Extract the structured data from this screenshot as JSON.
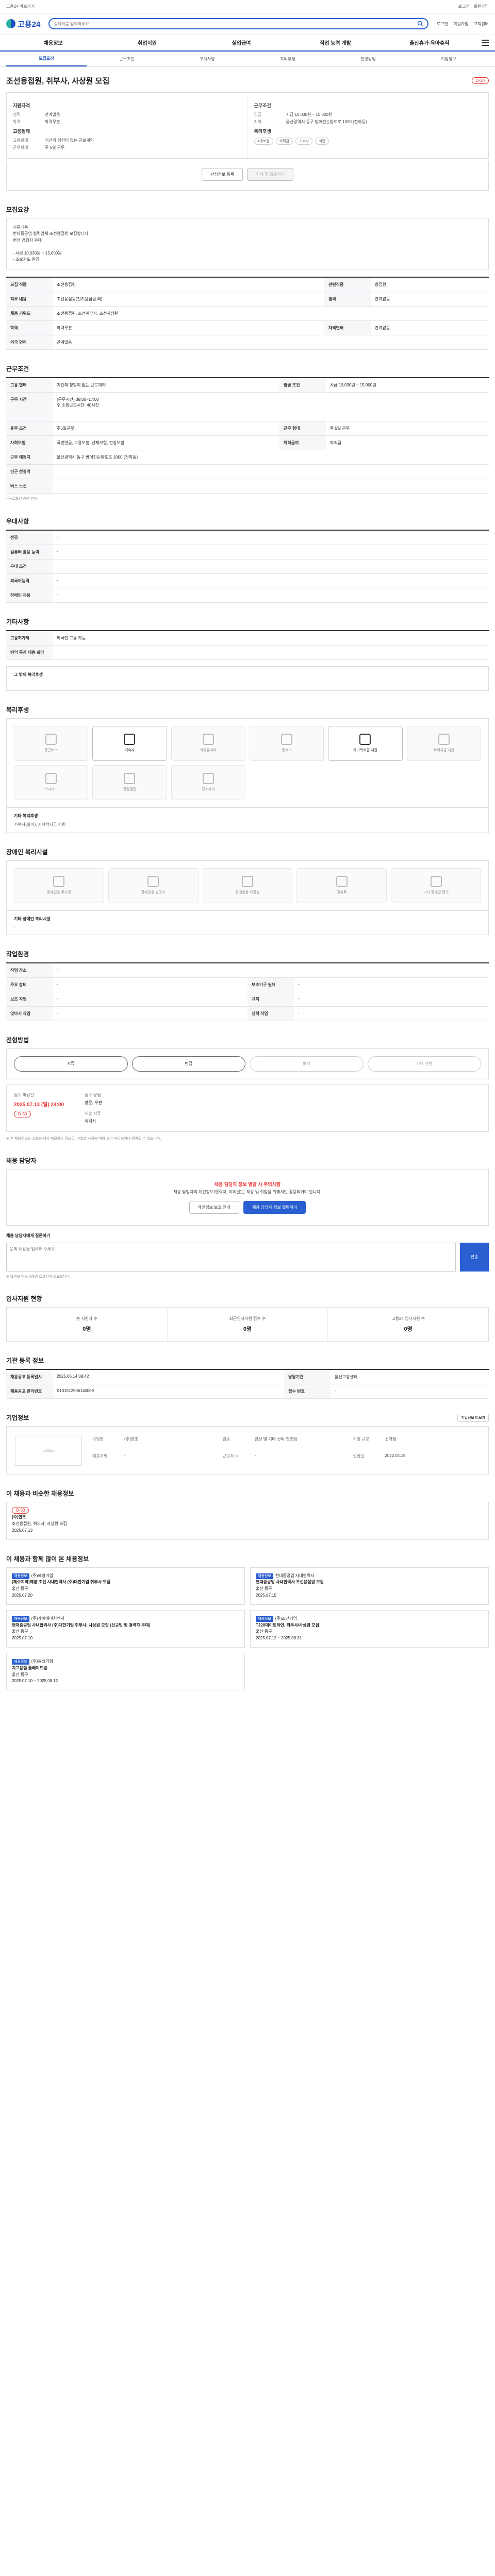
{
  "topbar": {
    "left": "고용24 바로가기",
    "right": [
      "로그인",
      "회원가입"
    ]
  },
  "header": {
    "logo": "고용24",
    "search_placeholder": "검색어를 입력하세요",
    "right": [
      "로그인",
      "회원가입",
      "고객센터"
    ]
  },
  "gnb": [
    "채용정보",
    "취업지원",
    "실업급여",
    "직업 능력 개발",
    "출산휴가·육아휴직"
  ],
  "tabs": [
    "모집요강",
    "근무조건",
    "우대사항",
    "복리후생",
    "전형방법",
    "기업정보"
  ],
  "title": "조선용접원, 취부사, 사상원 모집",
  "dday": "D-30",
  "summary": {
    "left_head": "지원자격",
    "left": [
      {
        "k": "경력",
        "v": "관계없음"
      },
      {
        "k": "학력",
        "v": "학력무관"
      }
    ],
    "left_head2": "고용형태",
    "left2": [
      {
        "k": "고용형태",
        "v": "기간의 정함이 없는 근로계약"
      },
      {
        "k": "근무형태",
        "v": "주 5일 근무"
      }
    ],
    "right_head": "근무조건",
    "right": [
      {
        "k": "임금",
        "v": "시급 10,030원 ~ 15,000원"
      },
      {
        "k": "지역",
        "v": "울산광역시 동구 방어진순환도로 1000 (전하동)"
      }
    ],
    "right_head2": "복리후생",
    "right_pills": [
      "4대보험",
      "퇴직금",
      "기숙사",
      "식당"
    ]
  },
  "buttons": {
    "interest": "관심정보 등록",
    "print": "인쇄 및 공유하기"
  },
  "sections": {
    "recruit": "모집요강",
    "duty_head": "직무내용",
    "duty_text": "직무내용\n현대중공업 협력업체 조선용접원 모집합니다.\n현장 경험자 우대\n\n- 시급 10,030원 ~ 15,000원\n- 초보자도 환영",
    "recruit_rows": [
      {
        "k": "모집 직종",
        "v": "조선용접원",
        "k2": "관련직종",
        "v2": "용접원"
      },
      {
        "k": "직무 내용",
        "v": "조선용접원(전기용접원 외)",
        "k2": "경력",
        "v2": "관계없음"
      },
      {
        "k": "채용 키워드",
        "v": "조선용접원, 조선취부사, 조선사상원",
        "k2": "",
        "v2": ""
      },
      {
        "k": "학력",
        "v": "학력무관",
        "k2": "자격면허",
        "v2": "관계없음"
      },
      {
        "k": "외국 면허",
        "v": "관계없음",
        "k2": "",
        "v2": ""
      }
    ],
    "work": "근무조건",
    "work_rows": [
      {
        "k": "고용 형태",
        "v": "기간의 정함이 없는 근로계약",
        "k2": "임금 조건",
        "v2": "시급 10,030원 ~ 15,000원"
      },
      {
        "k": "근무 시간",
        "v": "(근무시간) 08:00~17:00\n주 소정근로시간: 40시간",
        "k2": "",
        "v2": ""
      },
      {
        "k": "휴무 조건",
        "v": "주5일근무",
        "k2": "근무 형태",
        "v2": "주 5일 근무"
      },
      {
        "k": "사회보험",
        "v": "국민연금, 고용보험, 산재보험, 건강보험",
        "k2": "퇴직급여",
        "v2": "퇴직금"
      },
      {
        "k": "근무 예정지",
        "v": "울산광역시 동구 방어진순환도로 1000 (전하동)",
        "k2": "",
        "v2": ""
      },
      {
        "k": "인근 전철역",
        "v": "",
        "k2": "",
        "v2": ""
      },
      {
        "k": "버스 노선",
        "v": "",
        "k2": "",
        "v2": ""
      }
    ],
    "work_note": "* 근로조건 관련 안내",
    "pref": "우대사항",
    "pref_rows": [
      {
        "k": "전공",
        "v": "-"
      },
      {
        "k": "컴퓨터 활용 능력",
        "v": "-"
      },
      {
        "k": "우대 조건",
        "v": "-"
      },
      {
        "k": "외국어능력",
        "v": "-"
      },
      {
        "k": "장애인 채용",
        "v": "-"
      }
    ],
    "etc": "기타사항",
    "etc_rows": [
      {
        "k": "고용허가제",
        "v": "외국인 고용 가능"
      },
      {
        "k": "병역 특례 채용 희망",
        "v": "-"
      }
    ],
    "etc_box_head": "그 밖의 복리후생",
    "etc_box_text": "-",
    "welfare": "복리후생",
    "welfare_icons": [
      {
        "label": "통근버스",
        "on": false
      },
      {
        "label": "기숙사",
        "on": true
      },
      {
        "label": "차량유지비",
        "on": false
      },
      {
        "label": "중식비",
        "on": false
      },
      {
        "label": "자녀학자금 지원",
        "on": true
      },
      {
        "label": "주택자금 지원",
        "on": false
      },
      {
        "label": "복지카드",
        "on": false
      },
      {
        "label": "건강검진",
        "on": false
      },
      {
        "label": "경조사비",
        "on": false
      }
    ],
    "welfare_extra_head": "기타 복리후생",
    "welfare_extra_text": "기숙사(실비), 자녀학자금 지원",
    "disabled": "장애인 복리시설",
    "disabled_icons": [
      "장애인용 주차장",
      "장애인용 승강기",
      "장애인용 화장실",
      "경사로",
      "기타 장애인 편의"
    ],
    "disabled_extra_head": "기타 장애인 복리시설",
    "disabled_extra_text": "-",
    "env": "작업환경",
    "env_rows": [
      {
        "k": "작업 장소",
        "v": "-",
        "k2": "",
        "v2": ""
      },
      {
        "k": "주요 장비",
        "v": "-",
        "k2": "보조기구 필요",
        "v2": "-"
      },
      {
        "k": "보조 작업",
        "v": "-",
        "k2": "규칙",
        "v2": "-"
      },
      {
        "k": "앉아서 작업",
        "v": "-",
        "k2": "청력 작업",
        "v2": "-"
      }
    ],
    "process": "전형방법",
    "process_steps": [
      {
        "label": "서류",
        "on": true
      },
      {
        "label": "면접",
        "on": true
      },
      {
        "label": "필기",
        "on": false
      },
      {
        "label": "기타 전형",
        "on": false
      }
    ],
    "apply_lbl1": "접수 마감일",
    "apply_date": "2025.07.13 (일) 24:00",
    "apply_badge": "D-30",
    "apply_lbl2": "접수 방법",
    "apply_method": "방문, 우편",
    "apply_lbl3": "제출 서류",
    "apply_docs": "이력서",
    "apply_notice": "※ 본 채용정보는 고용24에서 제공하는 정보로, 기업의 사정에 따라 조기 마감되거나 변경될 수 있습니다.",
    "contact": "채용 담당자",
    "contact_alert": "채용 담당자 정보 열람 시 주의사항",
    "contact_text": "채용 담당자의 개인정보(연락처, 이메일)는 채용 및 취업을 위해서만 활용되어야 합니다.",
    "contact_btn1": "개인정보 보호 안내",
    "contact_btn2": "채용 담당자 정보 열람하기",
    "qa_head": "채용 담당자에게 질문하기",
    "qa_placeholder": "문의 내용을 입력해 주세요.",
    "qa_send": "전송",
    "qa_note": "※ 답변을 받으시려면 로그인이 필요합니다.",
    "stats": "입사지원 현황",
    "stats_cols": [
      {
        "label": "총 지원자 수",
        "n": "0명"
      },
      {
        "label": "최근입사지원 접수 수",
        "n": "0명"
      },
      {
        "label": "고용24 입사지원 수",
        "n": "0명"
      }
    ],
    "reg": "기관 등록 정보",
    "reg_rows": [
      {
        "k": "채용공고 등록일시",
        "v": "2025.06.14 09:42",
        "k2": "담당기관",
        "v2": "울산고용센터"
      },
      {
        "k": "채용공고 관리번호",
        "v": "K131512506140009",
        "k2": "접수 번호",
        "v2": "-"
      }
    ],
    "company": "기업정보",
    "company_logo": "LOGO",
    "company_rows": [
      {
        "k": "기업명",
        "v": "(주)한조"
      },
      {
        "k": "업종",
        "v": "강선 및 기타 선박 건조업"
      },
      {
        "k": "기업 규모",
        "v": "소기업"
      },
      {
        "k": "대표자명",
        "v": "-"
      },
      {
        "k": "근로자 수",
        "v": "-"
      },
      {
        "k": "설립일",
        "v": "2022.04.19"
      }
    ],
    "company_more": "기업정보 더보기",
    "similar": "이 채용과 비슷한 채용정보",
    "similar_box": [
      {
        "tag": "D-30",
        "title": "(주)한조",
        "line": "조선용접원, 취부사, 사상원 모집",
        "date": "2025.07.13"
      }
    ],
    "recommend": "이 채용과 함께 많이 본 채용정보",
    "cards": [
      {
        "tag": "채용정보",
        "co": "(주)해양기업",
        "title": "(제주지역)해양 조선 사내협력사 (주)대한기업 취부사 모집",
        "loc": "울산 동구",
        "date": "2025.07.20"
      },
      {
        "tag": "채용정보",
        "co": "현대중공업 사내협력사",
        "title": "현대중공업 사내협력사 조선용접원 모집",
        "loc": "울산 동구",
        "date": "2025.07.15"
      },
      {
        "tag": "채용정보",
        "co": "(주)케이에이치엔지",
        "title": "현대중공업 사내협력사 (주)대한기업 취부사, 사상원 모집 (신규입 및 경력자 우대)",
        "loc": "울산 동구",
        "date": "2025.07.10"
      },
      {
        "tag": "채용정보",
        "co": "(주)조선기업",
        "title": "T320데이토라인, 취부사/사상원 모집",
        "loc": "울산 동구",
        "date": "2025.07.12 ~ 2025.08.31"
      },
      {
        "tag": "채용정보",
        "co": "(주)동성기업",
        "title": "지그용접 플레이트원",
        "loc": "울산 동구",
        "date": "2025.07.10 ~ 2025.08.12"
      }
    ]
  }
}
